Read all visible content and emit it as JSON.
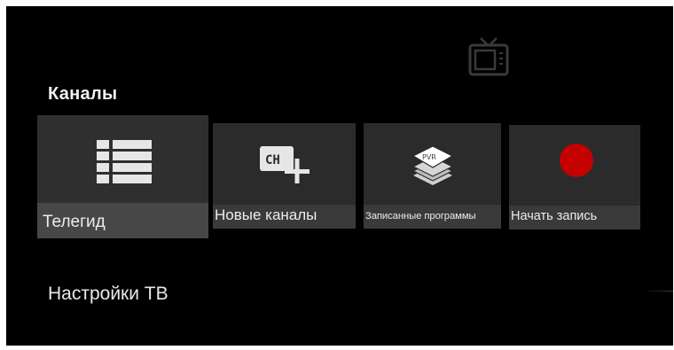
{
  "section": {
    "title": "Каналы"
  },
  "tiles": [
    {
      "label": "Телегид",
      "icon": "list-icon"
    },
    {
      "label": "Новые каналы",
      "icon": "ch-plus-icon",
      "icon_text": "CH"
    },
    {
      "label": "Записанные программы",
      "icon": "pvr-icon",
      "icon_text": "PVR"
    },
    {
      "label": "Начать запись",
      "icon": "record-icon"
    }
  ],
  "settings": {
    "label": "Настройки ТВ"
  },
  "colors": {
    "background": "#000000",
    "tile": "#2b2b2b",
    "label_bar": "#3a3a3a",
    "record": "#c40000",
    "text": "#ececec"
  }
}
